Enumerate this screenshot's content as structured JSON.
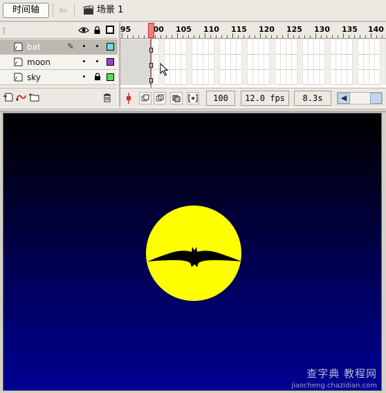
{
  "toolbar": {
    "timeline_label": "时间轴",
    "back_icon": "arrow-left-icon",
    "scene_label": "场景 1"
  },
  "layers": [
    {
      "name": "bat",
      "selected": true,
      "editing": true,
      "locked": false,
      "color": "#5fdfe9"
    },
    {
      "name": "moon",
      "selected": false,
      "editing": false,
      "locked": false,
      "color": "#9b44c8"
    },
    {
      "name": "sky",
      "selected": false,
      "editing": false,
      "locked": true,
      "color": "#55dd55"
    }
  ],
  "ruler": {
    "frames": [
      "95",
      "100",
      "105",
      "110",
      "115",
      "120",
      "125",
      "130",
      "135",
      "140"
    ]
  },
  "status": {
    "current_frame": "100",
    "frame_rate": "12.0 fps",
    "elapsed_time": "8.3s"
  },
  "watermark": {
    "line1": "查字典 教程网",
    "line2": "jiaocheng.chazidian.com"
  },
  "colors": {
    "moon": "#ffff00",
    "sky_top": "#000000",
    "sky_bottom": "#000093",
    "playhead": "#f08080"
  }
}
